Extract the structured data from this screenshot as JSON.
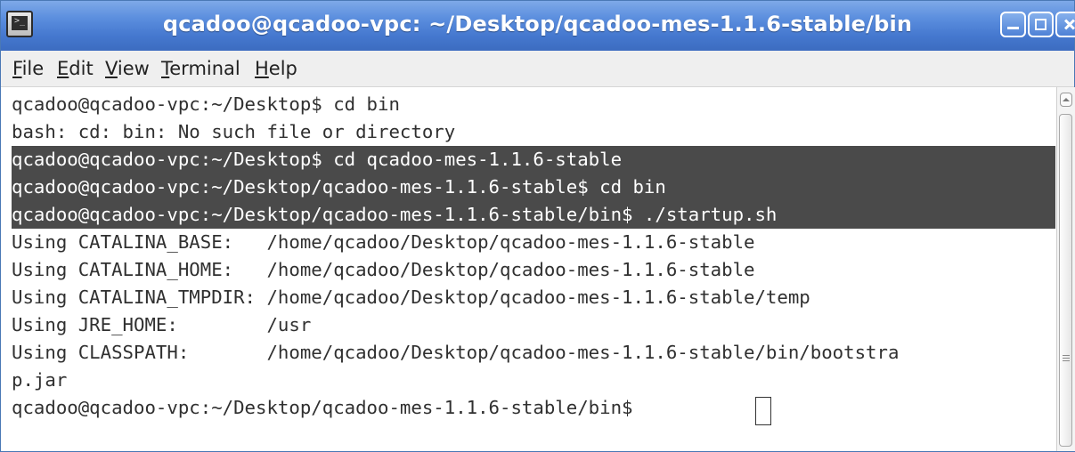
{
  "window": {
    "title": "qcadoo@qcadoo-vpc: ~/Desktop/qcadoo-mes-1.1.6-stable/bin",
    "app_icon": "terminal-icon",
    "controls": [
      "minimize-icon",
      "maximize-icon",
      "close-icon"
    ]
  },
  "menu": {
    "file": "File",
    "edit": "Edit",
    "view": "View",
    "terminal": "Terminal",
    "help": "Help"
  },
  "terminal": {
    "lines": [
      "qcadoo@qcadoo-vpc:~/Desktop$ cd bin",
      "bash: cd: bin: No such file or directory",
      "qcadoo@qcadoo-vpc:~/Desktop$ cd qcadoo-mes-1.1.6-stable",
      "qcadoo@qcadoo-vpc:~/Desktop/qcadoo-mes-1.1.6-stable$ cd bin",
      "qcadoo@qcadoo-vpc:~/Desktop/qcadoo-mes-1.1.6-stable/bin$ ./startup.sh",
      "Using CATALINA_BASE:   /home/qcadoo/Desktop/qcadoo-mes-1.1.6-stable",
      "Using CATALINA_HOME:   /home/qcadoo/Desktop/qcadoo-mes-1.1.6-stable",
      "Using CATALINA_TMPDIR: /home/qcadoo/Desktop/qcadoo-mes-1.1.6-stable/temp",
      "Using JRE_HOME:        /usr",
      "Using CLASSPATH:       /home/qcadoo/Desktop/qcadoo-mes-1.1.6-stable/bin/bootstra",
      "p.jar",
      "qcadoo@qcadoo-vpc:~/Desktop/qcadoo-mes-1.1.6-stable/bin$ "
    ],
    "selected_lines": [
      2,
      3,
      4
    ]
  },
  "colors": {
    "titlebar": "#4578cf",
    "selection_bg": "#4a4a4a",
    "text": "#303030"
  }
}
